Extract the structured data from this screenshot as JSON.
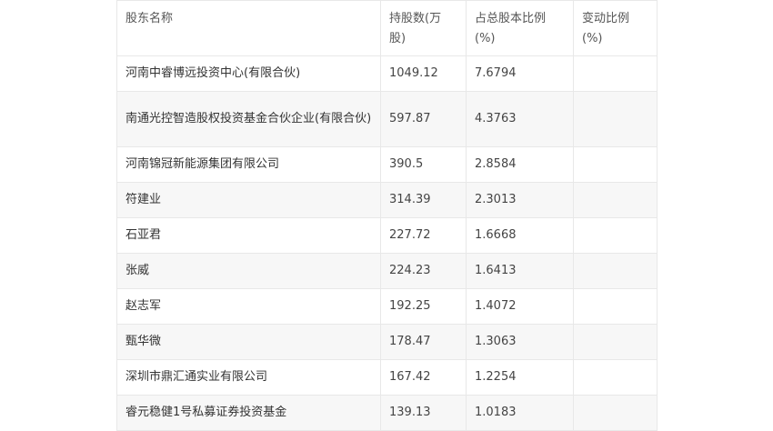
{
  "table": {
    "headers": [
      "股东名称",
      "持股数(万股)",
      "占总股本比例(%)",
      "变动比例(%)"
    ],
    "rows": [
      {
        "name": "河南中睿博远投资中心(有限合伙)",
        "shares": "1049.12",
        "ratio": "7.6794",
        "change": ""
      },
      {
        "name": "南通光控智造股权投资基金合伙企业(有限合伙)",
        "shares": "597.87",
        "ratio": "4.3763",
        "change": ""
      },
      {
        "name": "河南锦冠新能源集团有限公司",
        "shares": "390.5",
        "ratio": "2.8584",
        "change": ""
      },
      {
        "name": "符建业",
        "shares": "314.39",
        "ratio": "2.3013",
        "change": ""
      },
      {
        "name": "石亚君",
        "shares": "227.72",
        "ratio": "1.6668",
        "change": ""
      },
      {
        "name": "张威",
        "shares": "224.23",
        "ratio": "1.6413",
        "change": ""
      },
      {
        "name": "赵志军",
        "shares": "192.25",
        "ratio": "1.4072",
        "change": ""
      },
      {
        "name": "甄华微",
        "shares": "178.47",
        "ratio": "1.3063",
        "change": ""
      },
      {
        "name": "深圳市鼎汇通实业有限公司",
        "shares": "167.42",
        "ratio": "1.2254",
        "change": ""
      },
      {
        "name": "睿元稳健1号私募证券投资基金",
        "shares": "139.13",
        "ratio": "1.0183",
        "change": ""
      }
    ]
  }
}
